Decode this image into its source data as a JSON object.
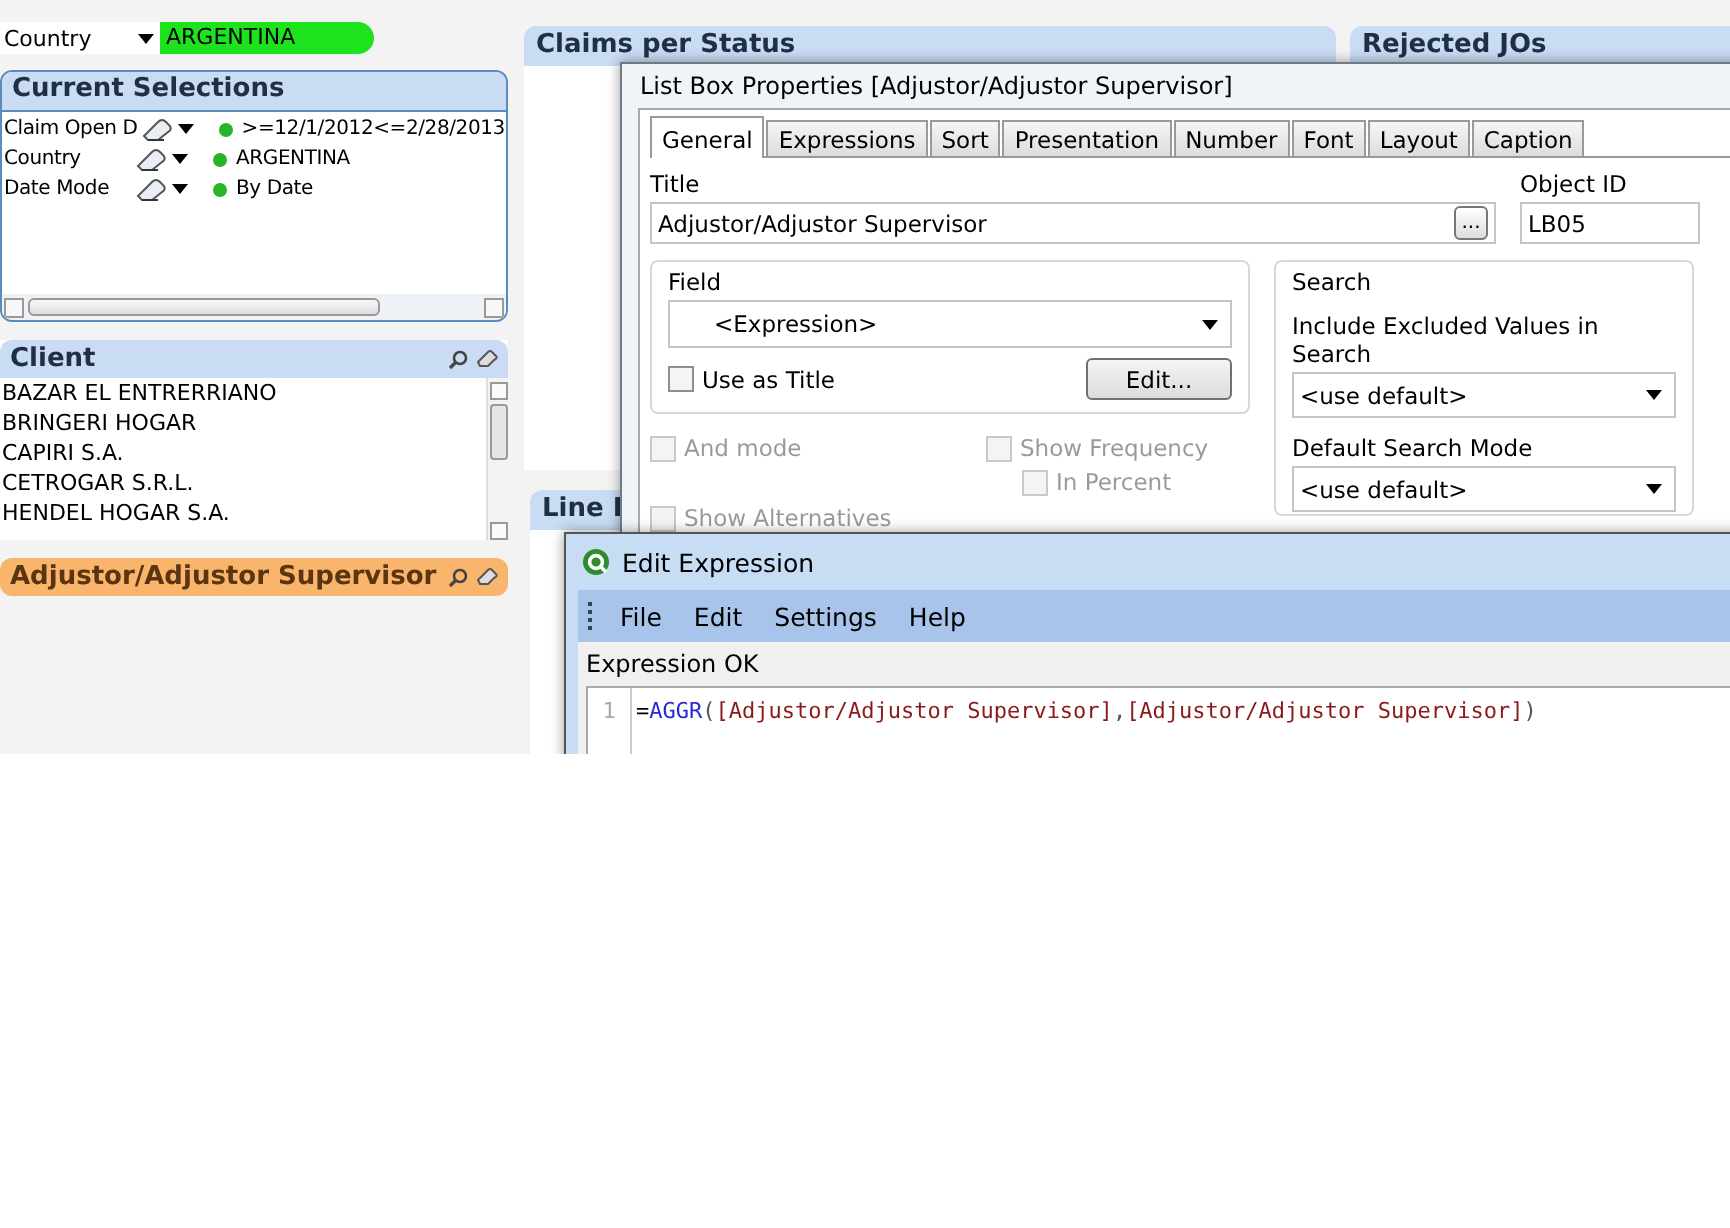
{
  "country_selector": {
    "label": "Country",
    "value": "ARGENTINA"
  },
  "current_selections": {
    "title": "Current Selections",
    "rows": [
      {
        "field": "Claim Open D",
        "value": ">=12/1/2012<=2/28/2013"
      },
      {
        "field": "Country",
        "value": "ARGENTINA"
      },
      {
        "field": "Date Mode",
        "value": "By Date"
      }
    ]
  },
  "client_listbox": {
    "title": "Client",
    "items": [
      "BAZAR EL ENTRERRIANO",
      "BRINGERI HOGAR",
      "CAPIRI S.A.",
      "CETROGAR S.R.L.",
      "HENDEL HOGAR S.A."
    ]
  },
  "adjustor_listbox": {
    "title": "Adjustor/Adjustor Supervisor"
  },
  "charts": [
    {
      "title": "Claims per Status"
    },
    {
      "title": "Rejected JOs"
    },
    {
      "title": "Line I"
    }
  ],
  "list_box_properties": {
    "title": "List Box Properties [Adjustor/Adjustor Supervisor]",
    "tabs": [
      {
        "label": "General",
        "selected": true
      },
      {
        "label": "Expressions",
        "selected": false
      },
      {
        "label": "Sort",
        "selected": false
      },
      {
        "label": "Presentation",
        "selected": false
      },
      {
        "label": "Number",
        "selected": false
      },
      {
        "label": "Font",
        "selected": false
      },
      {
        "label": "Layout",
        "selected": false
      },
      {
        "label": "Caption",
        "selected": false
      }
    ],
    "title_label": "Title",
    "title_value": "Adjustor/Adjustor Supervisor",
    "browse_button": "...",
    "object_id_label": "Object ID",
    "object_id_value": "LB05",
    "field": {
      "legend": "Field",
      "value": "<Expression>",
      "use_as_title": {
        "label": "Use as Title",
        "checked": false
      },
      "edit_button": "Edit..."
    },
    "options": [
      {
        "label": "And mode",
        "checked": false,
        "disabled": true
      },
      {
        "label": "Show Frequency",
        "checked": false,
        "disabled": true,
        "children": [
          {
            "label": "In Percent",
            "checked": false,
            "disabled": true
          }
        ]
      },
      {
        "label": "Show Alternatives",
        "checked": false,
        "disabled": true
      }
    ],
    "search": {
      "legend": "Search",
      "include_label": "Include Excluded Values in Search",
      "include_value": "<use default>",
      "mode_label": "Default Search Mode",
      "mode_value": "<use default>"
    }
  },
  "edit_expression": {
    "title": "Edit Expression",
    "menu": [
      "File",
      "Edit",
      "Settings",
      "Help"
    ],
    "status": "Expression OK",
    "lines": [
      {
        "number": "1",
        "tokens": [
          {
            "kind": "operator",
            "text": "="
          },
          {
            "kind": "function",
            "text": "AGGR"
          },
          {
            "kind": "punct",
            "text": "("
          },
          {
            "kind": "field",
            "text": "[Adjustor/Adjustor Supervisor]"
          },
          {
            "kind": "punct",
            "text": ","
          },
          {
            "kind": "field",
            "text": "[Adjustor/Adjustor Supervisor]"
          },
          {
            "kind": "punct",
            "text": ")"
          }
        ]
      }
    ]
  }
}
